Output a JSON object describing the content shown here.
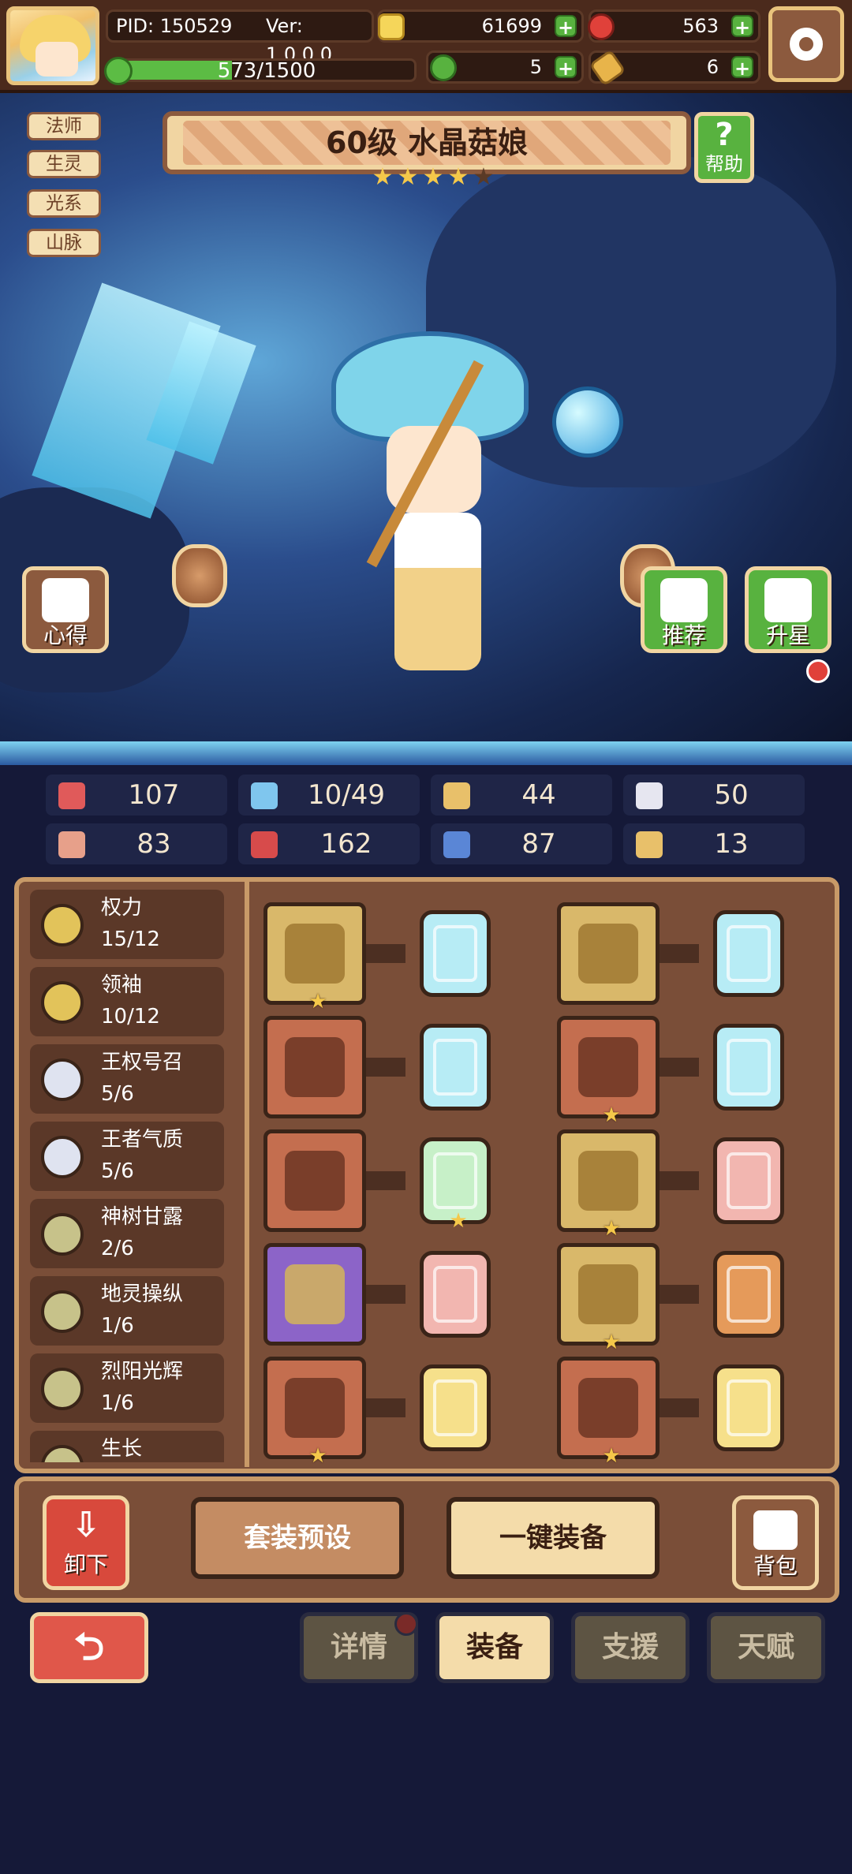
{
  "topbar": {
    "pid": "PID: 150529",
    "version": "Ver: 1.0.0.0",
    "gold": "61699",
    "gems": "563",
    "xp": "573/1500",
    "xp_fraction": 0.382,
    "clover": "5",
    "key": "6",
    "icons": [
      "avatar",
      "gold-coin-icon",
      "red-gem-icon",
      "green-clover-icon",
      "key-icon",
      "gear-icon"
    ]
  },
  "hero": {
    "tags": [
      "法师",
      "生灵",
      "光系",
      "山脉"
    ],
    "title": "60级 水晶菇娘",
    "stars_filled": 4,
    "stars_total": 5,
    "help_label": "帮助",
    "notes_label": "心得",
    "recommend_label": "推荐",
    "upstar_label": "升星"
  },
  "stats": [
    {
      "icon": "heart-icon",
      "value": "107",
      "color": "#e05a5a"
    },
    {
      "icon": "water-drop-icon",
      "value": "10/49",
      "color": "#7fc6ee"
    },
    {
      "icon": "shield-icon",
      "value": "44",
      "color": "#e8c06a"
    },
    {
      "icon": "wing-icon",
      "value": "50",
      "color": "#e6e6f0"
    },
    {
      "icon": "fist-icon",
      "value": "83",
      "color": "#e7a08a"
    },
    {
      "icon": "book-icon",
      "value": "162",
      "color": "#d74b4b"
    },
    {
      "icon": "boot-icon",
      "value": "87",
      "color": "#5a86d6"
    },
    {
      "icon": "horseshoe-icon",
      "value": "13",
      "color": "#e8c06a"
    }
  ],
  "skills": [
    {
      "name": "权力",
      "progress": "15/12",
      "tier": "gold"
    },
    {
      "name": "领袖",
      "progress": "10/12",
      "tier": "gold"
    },
    {
      "name": "王权号召",
      "progress": "5/6",
      "tier": "silver"
    },
    {
      "name": "王者气质",
      "progress": "5/6",
      "tier": "silver"
    },
    {
      "name": "神树甘露",
      "progress": "2/6",
      "tier": "olive"
    },
    {
      "name": "地灵操纵",
      "progress": "1/6",
      "tier": "olive"
    },
    {
      "name": "烈阳光辉",
      "progress": "1/6",
      "tier": "olive"
    },
    {
      "name": "生长",
      "progress": "",
      "tier": "olive"
    }
  ],
  "equipment": [
    {
      "item": "scepter-icon",
      "rarity": "gold",
      "star": true,
      "rune": "blue",
      "rune_star": false
    },
    {
      "item": "crown-icon",
      "rarity": "gold",
      "star": false,
      "rune": "blue",
      "rune_star": false
    },
    {
      "item": "stone-orb-icon",
      "rarity": "bronze",
      "star": false,
      "rune": "blue",
      "rune_star": false
    },
    {
      "item": "robe-icon",
      "rarity": "bronze",
      "star": true,
      "rune": "blue",
      "rune_star": false
    },
    {
      "item": "amulet-icon",
      "rarity": "bronze",
      "star": false,
      "rune": "green",
      "rune_star": true
    },
    {
      "item": "gauntlet-icon",
      "rarity": "gold",
      "star": true,
      "rune": "pink",
      "rune_star": false
    },
    {
      "item": "ruby-charm-icon",
      "rarity": "purple",
      "star": false,
      "rune": "pink",
      "rune_star": false
    },
    {
      "item": "belt-icon",
      "rarity": "gold",
      "star": true,
      "rune": "orange",
      "rune_star": false
    },
    {
      "item": "bracer-icon",
      "rarity": "bronze",
      "star": true,
      "rune": "yellow",
      "rune_star": false
    },
    {
      "item": "boots-icon",
      "rarity": "bronze",
      "star": true,
      "rune": "yellow",
      "rune_star": false
    }
  ],
  "actions": {
    "unload_label": "卸下",
    "preset_label": "套装预设",
    "equip_all_label": "一键装备",
    "bag_label": "背包"
  },
  "nav": {
    "back": "back-arrow-icon",
    "tabs": [
      "详情",
      "装备",
      "支援",
      "天赋"
    ],
    "active_tab": "装备"
  },
  "colors": {
    "panel": "#7a4e38",
    "panel_border": "#c89a68",
    "page_bg": "#151938",
    "gold_frame": "#d9b86a",
    "bronze_frame": "#c46e4f",
    "purple_frame": "#8c64c8"
  }
}
